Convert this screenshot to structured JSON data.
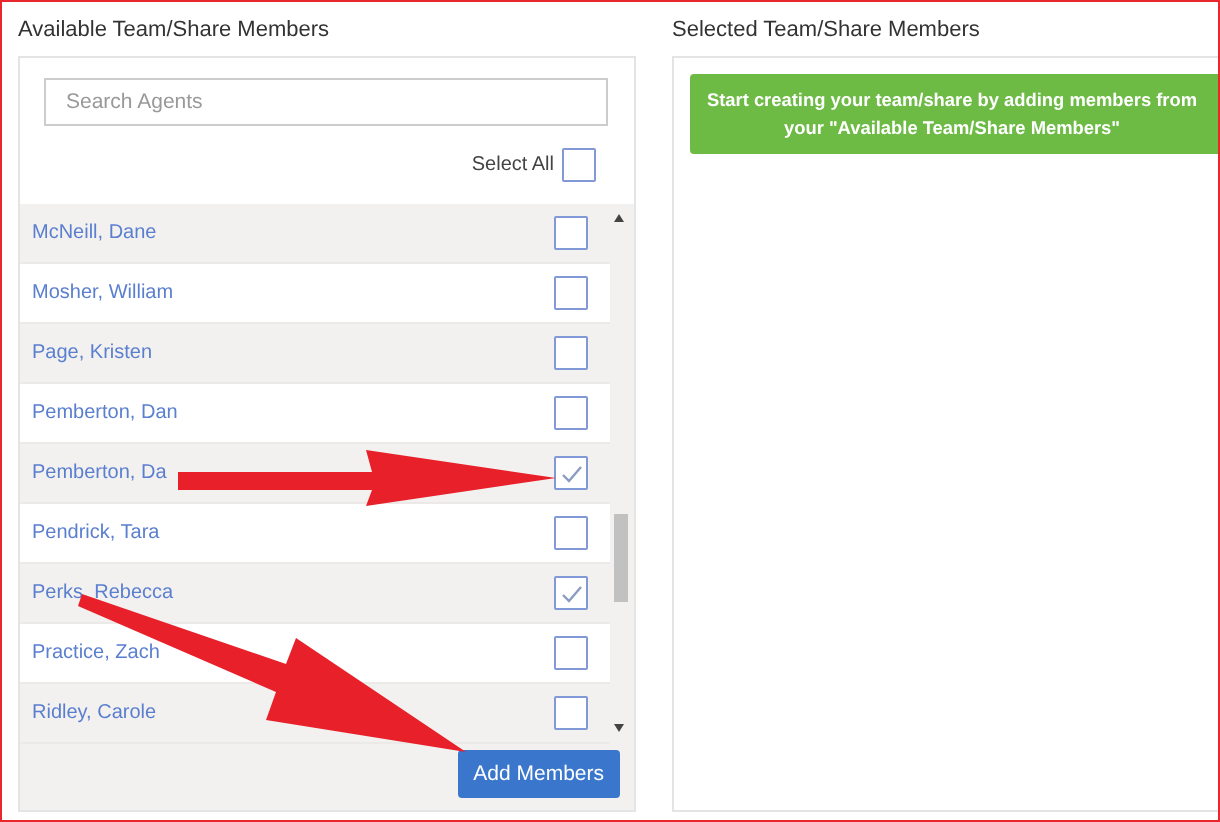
{
  "available": {
    "title": "Available Team/Share Members",
    "search": {
      "placeholder": "Search Agents"
    },
    "select_all": {
      "label": "Select All",
      "checked": false
    },
    "members": [
      {
        "name": "McNeill, Dane",
        "checked": false
      },
      {
        "name": "Mosher, William",
        "checked": false
      },
      {
        "name": "Page, Kristen",
        "checked": false
      },
      {
        "name": "Pemberton, Dan",
        "checked": false
      },
      {
        "name": "Pemberton, Da",
        "checked": true
      },
      {
        "name": "Pendrick, Tara",
        "checked": false
      },
      {
        "name": "Perks, Rebecca",
        "checked": true
      },
      {
        "name": "Practice, Zach",
        "checked": false
      },
      {
        "name": "Ridley, Carole",
        "checked": false
      }
    ],
    "add_button": "Add Members"
  },
  "selected": {
    "title": "Selected Team/Share Members",
    "message": "Start creating your team/share by adding members from your \"Available Team/Share Members\""
  }
}
